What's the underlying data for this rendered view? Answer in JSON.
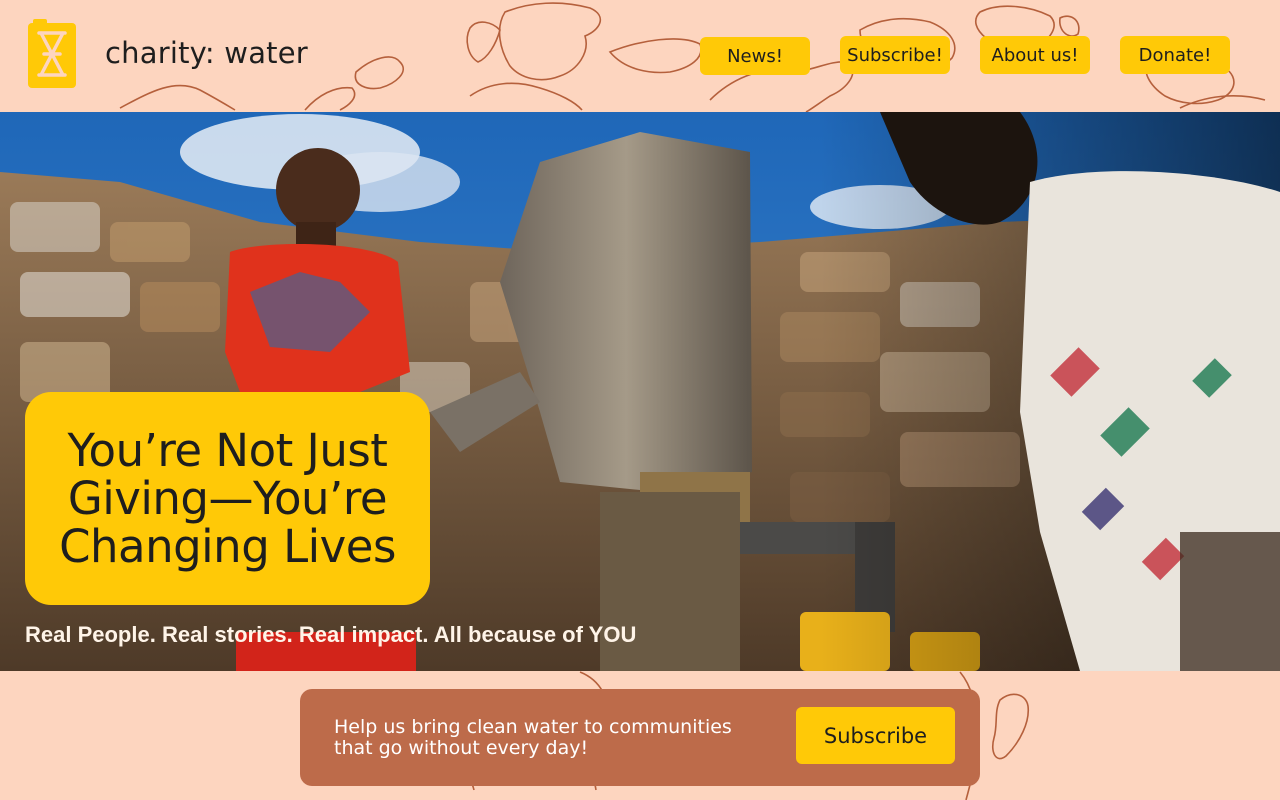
{
  "brand": {
    "name": "charity: water",
    "logo_icon": "jerry-can-icon",
    "logo_color": "#ffc907"
  },
  "nav": {
    "items": [
      {
        "label": "News!"
      },
      {
        "label": "Subscribe!"
      },
      {
        "label": "About us!"
      },
      {
        "label": "Donate!"
      }
    ]
  },
  "hero": {
    "headline": "You’re Not Just Giving—You’re Changing Lives",
    "tagline": "Real People. Real stories. Real impact. All because of YOU"
  },
  "subscribe_banner": {
    "text": "Help us bring clean water to communities that go without every day!",
    "button_label": "Subscribe"
  },
  "colors": {
    "background": "#fdd5bf",
    "accent_yellow": "#ffc907",
    "banner_brown": "#bd6b4a",
    "map_outline": "#b5603c"
  }
}
